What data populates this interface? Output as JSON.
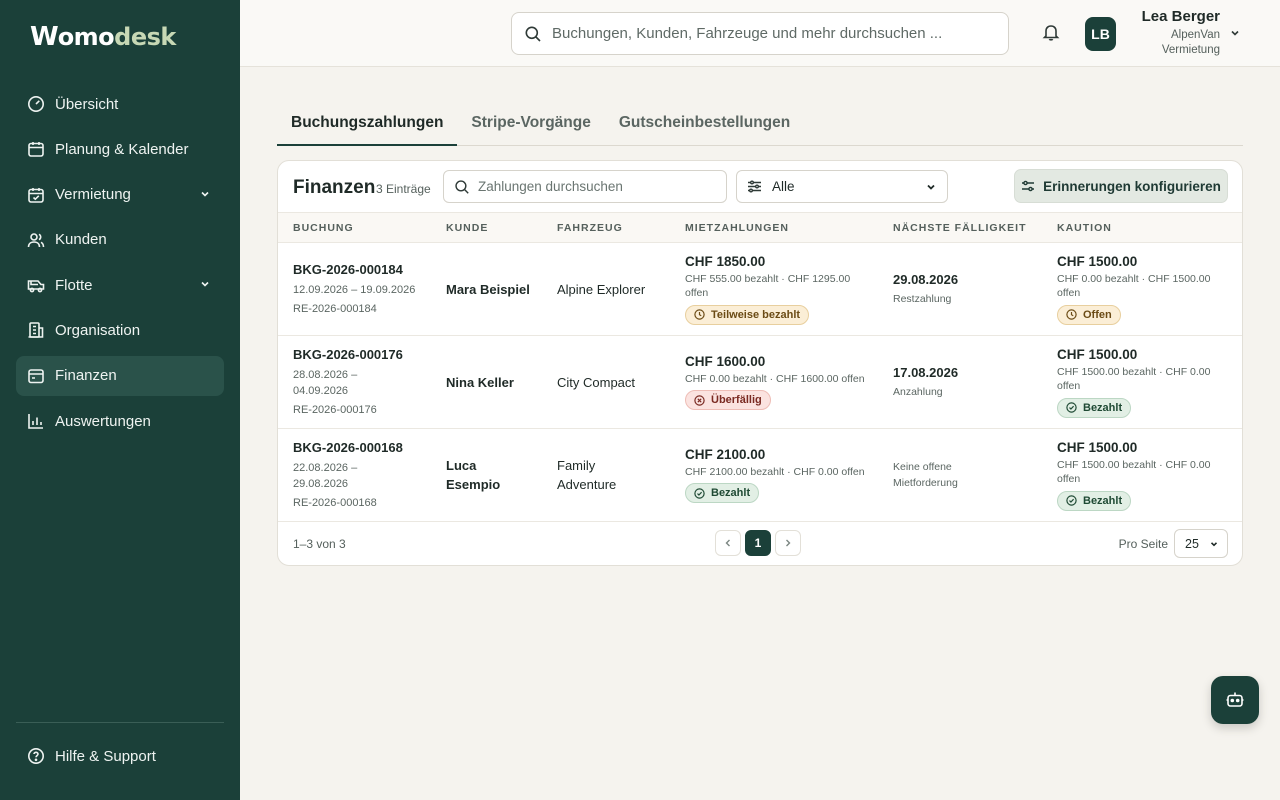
{
  "brand": {
    "logo_mark": "W",
    "logo_text_main": "omo",
    "logo_text_accent": "desk",
    "accent": "#1b4039"
  },
  "sidebar": {
    "items": [
      {
        "label": "Übersicht",
        "icon": "gauge-icon"
      },
      {
        "label": "Planung & Kalender",
        "icon": "calendar-icon"
      },
      {
        "label": "Vermietung",
        "icon": "calendar-check-icon",
        "expandable": true
      },
      {
        "label": "Kunden",
        "icon": "users-icon"
      },
      {
        "label": "Flotte",
        "icon": "van-icon",
        "expandable": true
      },
      {
        "label": "Organisation",
        "icon": "building-icon"
      },
      {
        "label": "Finanzen",
        "icon": "wallet-icon",
        "active": true
      },
      {
        "label": "Auswertungen",
        "icon": "bar-chart-icon"
      }
    ],
    "help_label": "Hilfe & Support"
  },
  "header": {
    "search_placeholder": "Buchungen, Kunden, Fahrzeuge und mehr durchsuchen ...",
    "user_initials": "LB",
    "user_name": "Lea Berger",
    "user_company": "AlpenVan Vermietung"
  },
  "tabs": [
    {
      "label": "Buchungszahlungen",
      "active": true
    },
    {
      "label": "Stripe-Vorgänge"
    },
    {
      "label": "Gutscheinbestellungen"
    }
  ],
  "finance": {
    "title": "Finanzen",
    "count": "3 Einträge",
    "search_placeholder": "Zahlungen durchsuchen",
    "filter_value": "Alle",
    "reminder_button": "Erinnerungen konfigurieren",
    "columns": [
      "BUCHUNG",
      "KUNDE",
      "FAHRZEUG",
      "MIETZAHLUNGEN",
      "NÄCHSTE FÄLLIGKEIT",
      "KAUTION"
    ],
    "rows": [
      {
        "booking_id": "BKG-2026-000184",
        "dates": "12.09.2026 – 19.09.2026",
        "invoice": "RE-2026-000184",
        "customer": "Mara Beispiel",
        "vehicle": "Alpine Explorer",
        "rent_amount": "CHF 1850.00",
        "rent_paid": "CHF 555.00 bezahlt · CHF 1295.00 offen",
        "rent_status": "Teilweise bezahlt",
        "due_date": "29.08.2026",
        "due_label": "Restzahlung",
        "deposit_amount": "CHF 1500.00",
        "deposit_paid": "CHF 0.00 bezahlt · CHF 1500.00 offen",
        "deposit_status": "Offen"
      },
      {
        "booking_id": "BKG-2026-000176",
        "dates": "28.08.2026 – 04.09.2026",
        "invoice": "RE-2026-000176",
        "customer": "Nina Keller",
        "vehicle": "City Compact",
        "rent_amount": "CHF 1600.00",
        "rent_paid": "CHF 0.00 bezahlt · CHF 1600.00 offen",
        "rent_status": "Überfällig",
        "due_date": "17.08.2026",
        "due_label": "Anzahlung",
        "deposit_amount": "CHF 1500.00",
        "deposit_paid": "CHF 1500.00 bezahlt · CHF 0.00 offen",
        "deposit_status": "Bezahlt"
      },
      {
        "booking_id": "BKG-2026-000168",
        "dates": "22.08.2026 – 29.08.2026",
        "invoice": "RE-2026-000168",
        "customer": "Luca Esempio",
        "vehicle": "Family Adventure",
        "rent_amount": "CHF 2100.00",
        "rent_paid": "CHF 2100.00 bezahlt · CHF 0.00 offen",
        "rent_status": "Bezahlt",
        "due_date": "",
        "due_label": "Keine offene Mietforderung",
        "deposit_amount": "CHF 1500.00",
        "deposit_paid": "CHF 1500.00 bezahlt · CHF 0.00 offen",
        "deposit_status": "Bezahlt"
      }
    ],
    "footer": {
      "range": "1–3 von 3",
      "current_page": "1",
      "per_page_label": "Pro Seite",
      "per_page_value": "25"
    }
  }
}
